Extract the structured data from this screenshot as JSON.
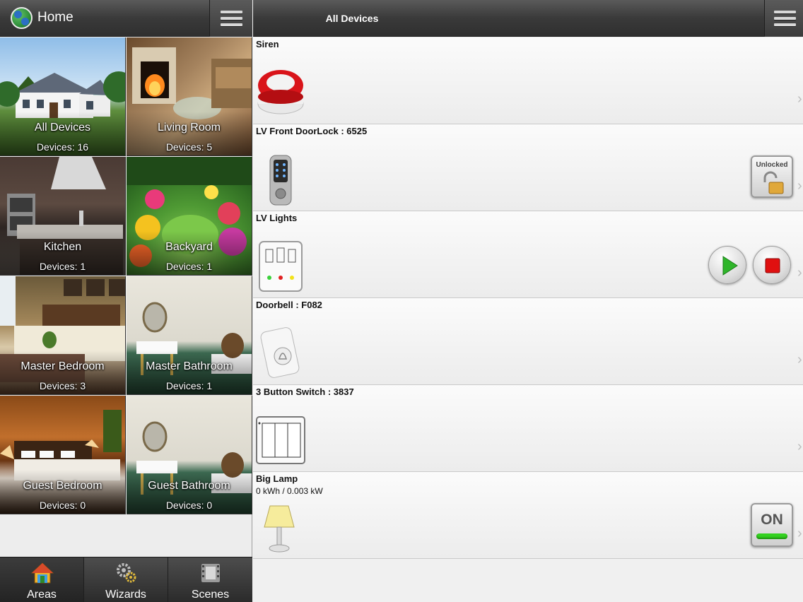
{
  "left_header": {
    "title": "Home"
  },
  "areas": [
    {
      "name": "All Devices",
      "count": "Devices: 16"
    },
    {
      "name": "Living Room",
      "count": "Devices: 5"
    },
    {
      "name": "Kitchen",
      "count": "Devices: 1"
    },
    {
      "name": "Backyard",
      "count": "Devices: 1"
    },
    {
      "name": "Master Bedroom",
      "count": "Devices: 3"
    },
    {
      "name": "Master Bathroom",
      "count": "Devices: 1"
    },
    {
      "name": "Guest Bedroom",
      "count": "Devices: 0"
    },
    {
      "name": "Guest Bathroom",
      "count": "Devices: 0"
    }
  ],
  "tabs": [
    {
      "label": "Areas",
      "icon": "house-icon"
    },
    {
      "label": "Wizards",
      "icon": "gears-icon"
    },
    {
      "label": "Scenes",
      "icon": "film-icon"
    }
  ],
  "right_header": {
    "title": "All Devices"
  },
  "devices": [
    {
      "name": "Siren",
      "icon": "siren-icon"
    },
    {
      "name": "LV Front DoorLock : 6525",
      "icon": "door-lock-icon",
      "control": {
        "label": "Unlocked"
      }
    },
    {
      "name": "LV Lights",
      "icon": "light-switch-panel-icon"
    },
    {
      "name": "Doorbell : F082",
      "icon": "doorbell-icon"
    },
    {
      "name": "3 Button Switch : 3837",
      "icon": "three-button-switch-icon"
    },
    {
      "name": "Big Lamp",
      "detail": "0 kWh / 0.003 kW",
      "icon": "lamp-icon",
      "control": {
        "label": "ON"
      }
    }
  ],
  "colors": {
    "accent_green": "#33d11f",
    "stop_red": "#e01010",
    "play_green": "#2fb52a"
  }
}
